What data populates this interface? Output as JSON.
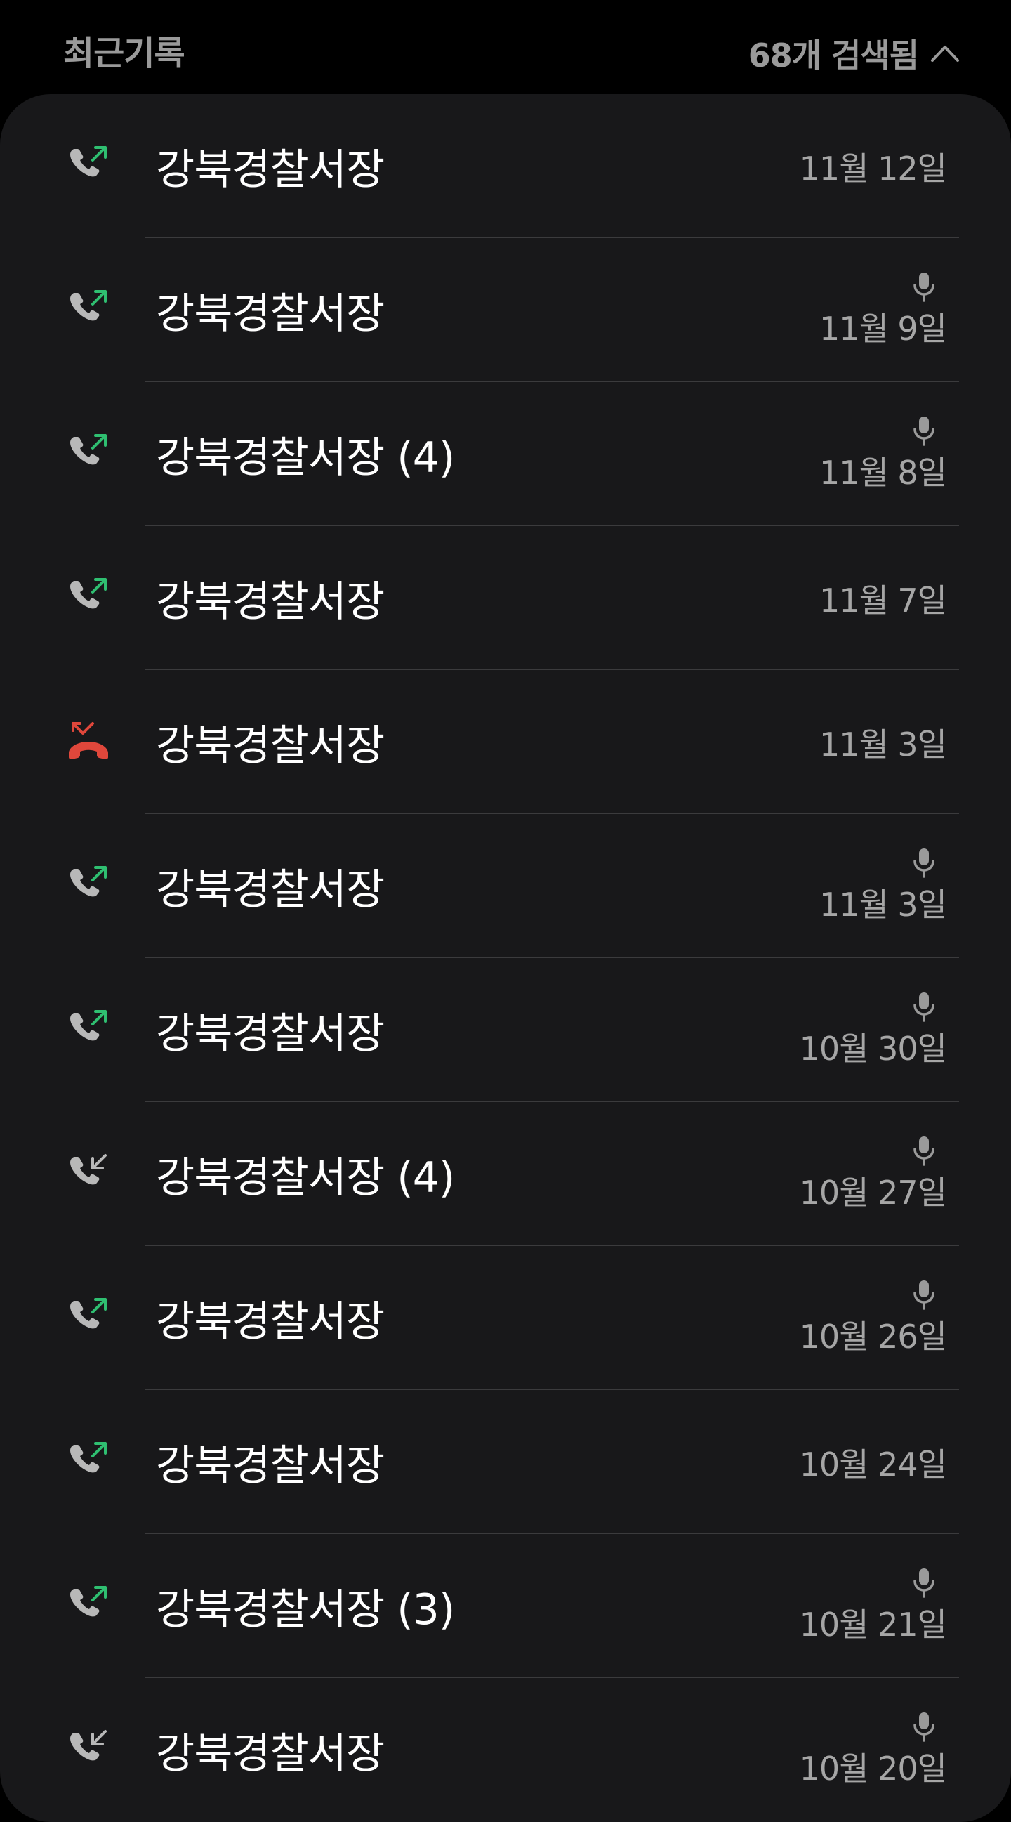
{
  "header": {
    "title": "최근기록",
    "result_count": "68개 검색됨",
    "collapse_icon": "chevron-up-icon"
  },
  "colors": {
    "background": "#000000",
    "card": "#18181a",
    "outgoing_arrow": "#2fbf71",
    "missed": "#e0473b",
    "phone_gray": "#b8b8b8",
    "date_gray": "#a6a6a6"
  },
  "calls": [
    {
      "name": "강북경찰서장",
      "date": "11월 12일",
      "type": "outgoing",
      "recorded": false
    },
    {
      "name": "강북경찰서장",
      "date": "11월 9일",
      "type": "outgoing",
      "recorded": true
    },
    {
      "name": "강북경찰서장 (4)",
      "date": "11월 8일",
      "type": "outgoing",
      "recorded": true
    },
    {
      "name": "강북경찰서장",
      "date": "11월 7일",
      "type": "outgoing",
      "recorded": false
    },
    {
      "name": "강북경찰서장",
      "date": "11월 3일",
      "type": "missed",
      "recorded": false
    },
    {
      "name": "강북경찰서장",
      "date": "11월 3일",
      "type": "outgoing",
      "recorded": true
    },
    {
      "name": "강북경찰서장",
      "date": "10월 30일",
      "type": "outgoing",
      "recorded": true
    },
    {
      "name": "강북경찰서장 (4)",
      "date": "10월 27일",
      "type": "incoming",
      "recorded": true
    },
    {
      "name": "강북경찰서장",
      "date": "10월 26일",
      "type": "outgoing",
      "recorded": true
    },
    {
      "name": "강북경찰서장",
      "date": "10월 24일",
      "type": "outgoing",
      "recorded": false
    },
    {
      "name": "강북경찰서장 (3)",
      "date": "10월 21일",
      "type": "outgoing",
      "recorded": true
    },
    {
      "name": "강북경찰서장",
      "date": "10월 20일",
      "type": "incoming",
      "recorded": true
    }
  ]
}
